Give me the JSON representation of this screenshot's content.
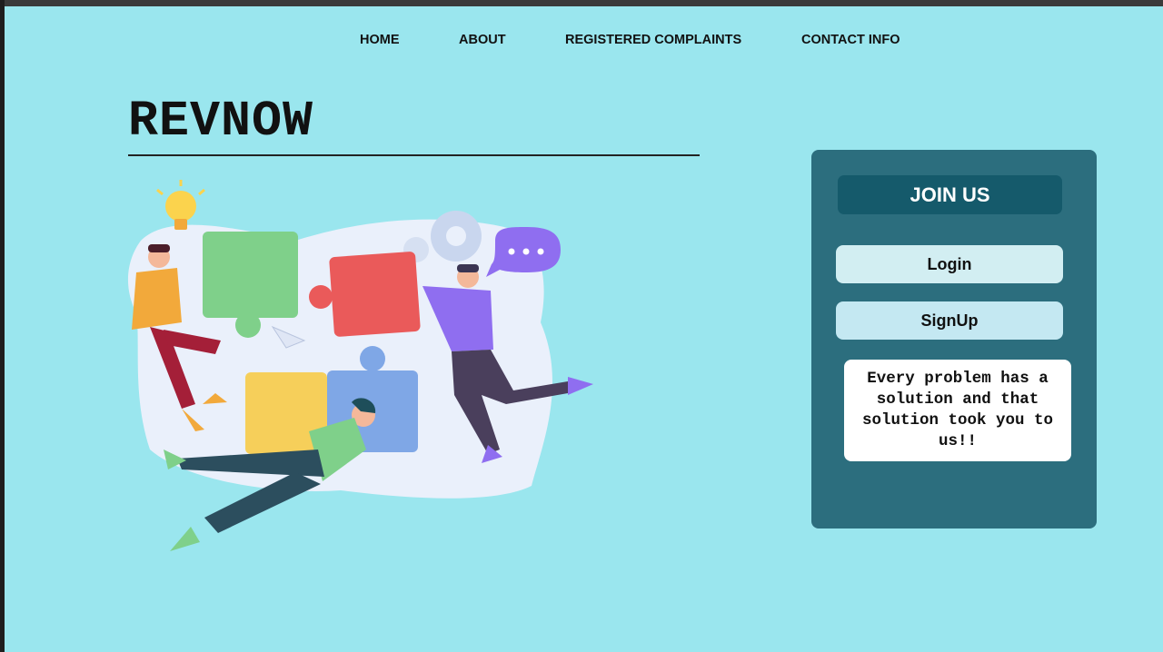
{
  "nav": {
    "items": [
      "HOME",
      "ABOUT",
      "REGISTERED COMPLAINTS",
      "CONTACT INFO"
    ]
  },
  "brand": {
    "title": "REVNOW"
  },
  "illustration": {
    "description_icons": [
      "puzzle-pieces",
      "lightbulb-icon",
      "gear-icon",
      "chat-bubble-icon",
      "paper-plane-icon"
    ],
    "colors": {
      "blob": "#e8eefb",
      "green": "#7fd08a",
      "red": "#ea5a5a",
      "yellow": "#f6cf5a",
      "blue": "#7fa7e6",
      "purple": "#8f6ef0"
    }
  },
  "join_panel": {
    "heading": "JOIN US",
    "login_label": "Login",
    "signup_label": "SignUp",
    "tagline": "Every problem has a solution and that solution took you to us!!"
  },
  "colors": {
    "background": "#9ae6ee",
    "panel": "#2c6e7e",
    "panel_heading": "#155a6b"
  }
}
